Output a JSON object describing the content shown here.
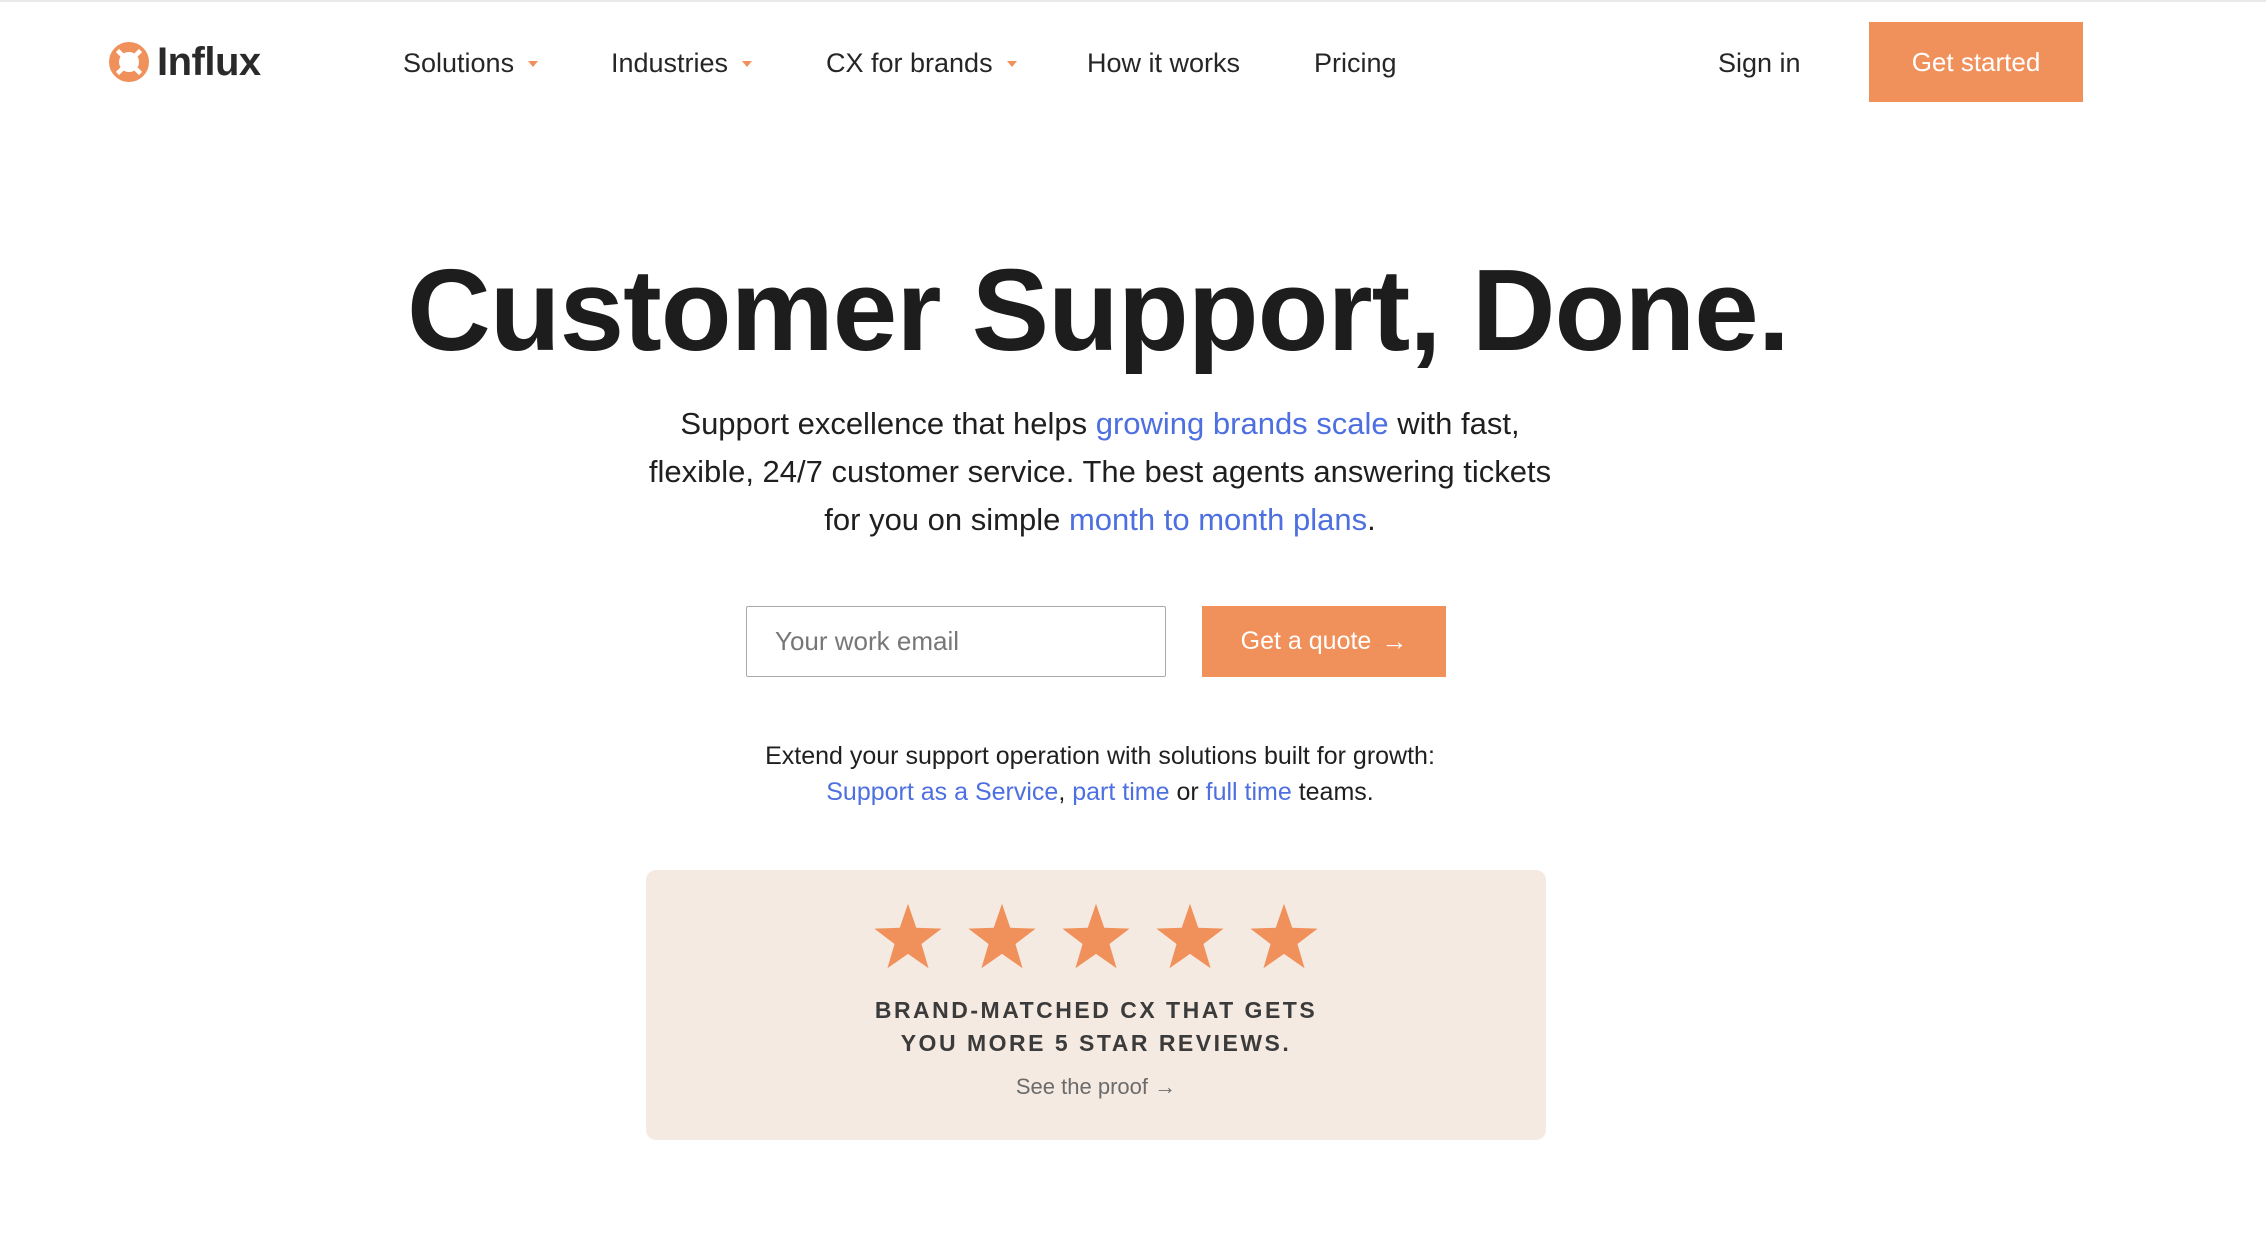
{
  "brand": {
    "name": "Influx",
    "logo_icon": "lifebuoy-icon",
    "accent_color": "#f0905a",
    "link_color": "#4d6fe0"
  },
  "nav": {
    "items": [
      {
        "label": "Solutions",
        "has_dropdown": true
      },
      {
        "label": "Industries",
        "has_dropdown": true
      },
      {
        "label": "CX for brands",
        "has_dropdown": true
      },
      {
        "label": "How it works",
        "has_dropdown": false
      },
      {
        "label": "Pricing",
        "has_dropdown": false
      }
    ],
    "sign_in": "Sign in",
    "cta": "Get started"
  },
  "hero": {
    "title": "Customer Support, Done.",
    "subtitle": {
      "part1": "Support excellence that helps ",
      "link1": "growing brands scale",
      "part2": " with fast, flexible, 24/7 customer service. The best agents answering tickets for you on simple ",
      "link2": "month to month plans",
      "part3": "."
    },
    "email_placeholder": "Your work email",
    "quote_button": "Get a quote",
    "quote_arrow": "→"
  },
  "extend": {
    "line1": "Extend your support operation with solutions built for growth:",
    "link_saas": "Support as a Service",
    "comma": ",",
    "link_part_time": "part time",
    "or": " or ",
    "link_full_time": "full time",
    "teams": " teams."
  },
  "review": {
    "star_count": 5,
    "rating": 5,
    "star_color": "#f0905a",
    "headline_line1": "BRAND-MATCHED CX THAT GETS",
    "headline_line2": "YOU MORE 5 STAR REVIEWS.",
    "proof_link": "See the proof",
    "proof_arrow": "→"
  }
}
